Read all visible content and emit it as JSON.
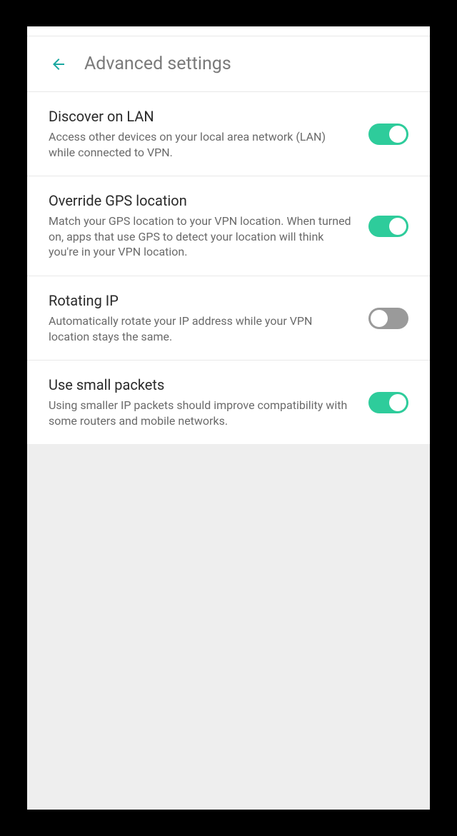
{
  "header": {
    "title": "Advanced settings"
  },
  "settings": [
    {
      "title": "Discover on LAN",
      "description": "Access other devices on your local area network (LAN) while connected to VPN.",
      "enabled": true,
      "name": "discover-on-lan"
    },
    {
      "title": "Override GPS location",
      "description": "Match your GPS location to your VPN location. When turned on, apps that use GPS to detect your location will think you're in your VPN location.",
      "enabled": true,
      "name": "override-gps-location"
    },
    {
      "title": "Rotating IP",
      "description": "Automatically rotate your IP address while your VPN location stays the same.",
      "enabled": false,
      "name": "rotating-ip"
    },
    {
      "title": "Use small packets",
      "description": "Using smaller IP packets should improve compatibility with some routers and mobile networks.",
      "enabled": true,
      "name": "use-small-packets"
    }
  ]
}
